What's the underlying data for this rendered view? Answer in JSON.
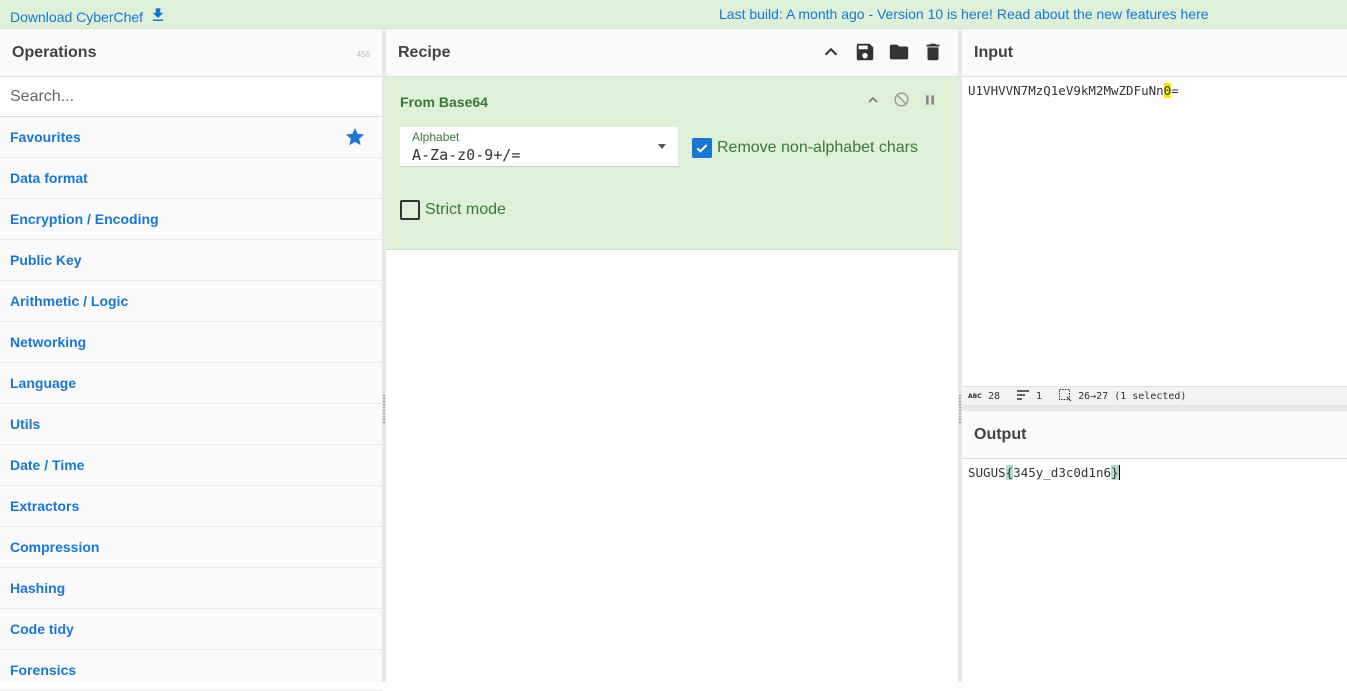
{
  "banner": {
    "download_label": "Download CyberChef",
    "build_prefix": "Last build: A month ago - Version 10 is here! Read about the new features ",
    "build_link": "here"
  },
  "operations": {
    "title": "Operations",
    "count": "456",
    "search_placeholder": "Search...",
    "categories": [
      {
        "label": "Favourites"
      },
      {
        "label": "Data format"
      },
      {
        "label": "Encryption / Encoding"
      },
      {
        "label": "Public Key"
      },
      {
        "label": "Arithmetic / Logic"
      },
      {
        "label": "Networking"
      },
      {
        "label": "Language"
      },
      {
        "label": "Utils"
      },
      {
        "label": "Date / Time"
      },
      {
        "label": "Extractors"
      },
      {
        "label": "Compression"
      },
      {
        "label": "Hashing"
      },
      {
        "label": "Code tidy"
      },
      {
        "label": "Forensics"
      }
    ]
  },
  "recipe": {
    "title": "Recipe",
    "operation": {
      "name": "From Base64",
      "alphabet_label": "Alphabet",
      "alphabet_value": "A-Za-z0-9+/=",
      "remove_non_alpha_label": "Remove non-alphabet chars",
      "remove_non_alpha_checked": true,
      "strict_mode_label": "Strict mode",
      "strict_mode_checked": false
    }
  },
  "input": {
    "title": "Input",
    "text_before": "U1VHVVN7MzQ1eV9kM2MwZDFuNn",
    "text_highlight": "0",
    "text_after": "=",
    "stats": {
      "length": "28",
      "lines": "1",
      "selection": "26→27 (1 selected)"
    }
  },
  "output": {
    "title": "Output",
    "text_prefix": "SUGUS",
    "text_open": "{",
    "text_middle": "345y_d3c0d1n6",
    "text_close": "}"
  },
  "colors": {
    "accent": "#1976d2",
    "op_bg": "#dff0d8",
    "op_text": "#3c763d",
    "highlight": "#ffe600"
  }
}
